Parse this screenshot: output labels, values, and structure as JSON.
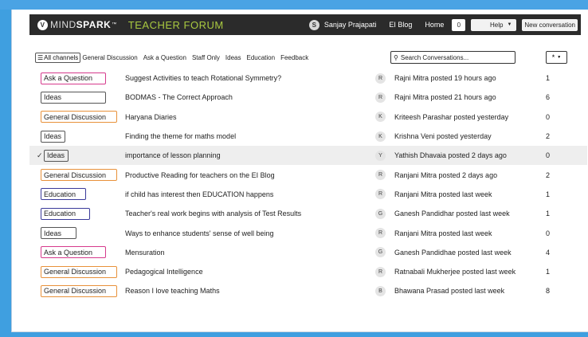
{
  "colors": {
    "background": "#3f9fe0",
    "header_bg": "#2b2b2b",
    "forum_title": "#a9c940",
    "tag_ask": "#d63a8c",
    "tag_ideas": "#555555",
    "tag_general": "#e8913a",
    "tag_education": "#3a3a9a"
  },
  "header": {
    "logo_badge": "V",
    "logo_light": "MIND",
    "logo_bold": "SPARK",
    "logo_mark": "™",
    "forum_title": "TEACHER FORUM",
    "user_initial": "S",
    "user_name": "Sanjay Prajapati",
    "blog_link": "EI Blog",
    "home_link": "Home",
    "notification_count": "0",
    "help_label": "Help",
    "new_conversation_label": "New conversation"
  },
  "filters": {
    "all_channels": "All channels",
    "channels": [
      "General Discussion",
      "Ask a Question",
      "Staff Only",
      "Ideas",
      "Education",
      "Feedback"
    ],
    "search_placeholder": "Search Conversations...",
    "star_label": "*"
  },
  "conversations": [
    {
      "tag": "Ask a Question",
      "title": "Suggest Activities to teach Rotational Symmetry?",
      "initial": "R",
      "posted": "Rajni Mitra posted 19 hours ago",
      "count": "1"
    },
    {
      "tag": "Ideas",
      "title": "BODMAS - The Correct Approach",
      "initial": "R",
      "posted": "Rajni Mitra posted 21 hours ago",
      "count": "6"
    },
    {
      "tag": "General Discussion",
      "title": "Haryana Diaries",
      "initial": "K",
      "posted": "Kriteesh Parashar posted yesterday",
      "count": "0"
    },
    {
      "tag": "Ideas",
      "title": "Finding the theme for maths model",
      "initial": "K",
      "posted": "Krishna Veni posted yesterday",
      "count": "2"
    },
    {
      "tag": "Ideas",
      "title": "importance of lesson planning",
      "initial": "Y",
      "posted": "Yathish Dhavaia posted 2 days ago",
      "count": "0",
      "check": "✓"
    },
    {
      "tag": "General Discussion",
      "title": "Productive Reading for teachers on the EI Blog",
      "initial": "R",
      "posted": "Ranjani Mitra posted  2 days ago",
      "count": "2"
    },
    {
      "tag": "Education",
      "title": "if child has interest then EDUCATION happens",
      "initial": "R",
      "posted": "Ranjani Mitra posted  last week",
      "count": "1"
    },
    {
      "tag": "Education",
      "title": "Teacher's real work begins with analysis of Test Results",
      "initial": "G",
      "posted": "Ganesh Pandidhar posted last week",
      "count": "1"
    },
    {
      "tag": "Ideas",
      "title": "Ways to enhance students' sense of well being",
      "initial": "R",
      "posted": "Ranjani Mitra posted last week",
      "count": "0"
    },
    {
      "tag": "Ask a Question",
      "title": "Mensuration",
      "initial": "G",
      "posted": "Ganesh Pandidhae posted last week",
      "count": "4"
    },
    {
      "tag": "General Discussion",
      "title": "Pedagogical Intelligence",
      "initial": "R",
      "posted": "Ratnabali Mukherjee posted last week",
      "count": "1"
    },
    {
      "tag": "General Discussion",
      "title": "Reason I love teaching Maths",
      "initial": "B",
      "posted": "Bhawana Prasad posted last week",
      "count": "8"
    }
  ]
}
